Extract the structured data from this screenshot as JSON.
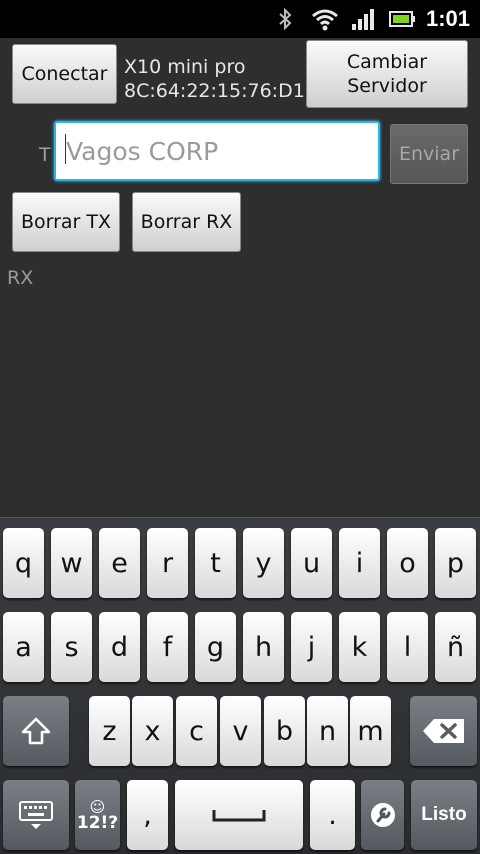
{
  "statusbar": {
    "time": "1:01",
    "icons": [
      "bluetooth-icon",
      "wifi-icon",
      "signal-icon",
      "battery-icon"
    ]
  },
  "toolbar": {
    "connect_label": "Conectar",
    "device_name": "X10 mini pro",
    "device_mac": "8C:64:22:15:76:D1",
    "change_server_label": "Cambiar\nServidor"
  },
  "tx": {
    "label": "T",
    "placeholder": "Vagos CORP",
    "value": "",
    "send_label": "Enviar"
  },
  "actions": {
    "clear_tx_label": "Borrar TX",
    "clear_rx_label": "Borrar RX"
  },
  "rx": {
    "label": "RX"
  },
  "keyboard": {
    "row1": [
      "q",
      "w",
      "e",
      "r",
      "t",
      "y",
      "u",
      "i",
      "o",
      "p"
    ],
    "row2": [
      "a",
      "s",
      "d",
      "f",
      "g",
      "h",
      "j",
      "k",
      "l",
      "ñ"
    ],
    "row3": [
      "z",
      "x",
      "c",
      "v",
      "b",
      "n",
      "m"
    ],
    "symbols_label": "12!?",
    "comma": ",",
    "period": ".",
    "done_label": "Listo",
    "accent_color": "#2bb4e8"
  }
}
